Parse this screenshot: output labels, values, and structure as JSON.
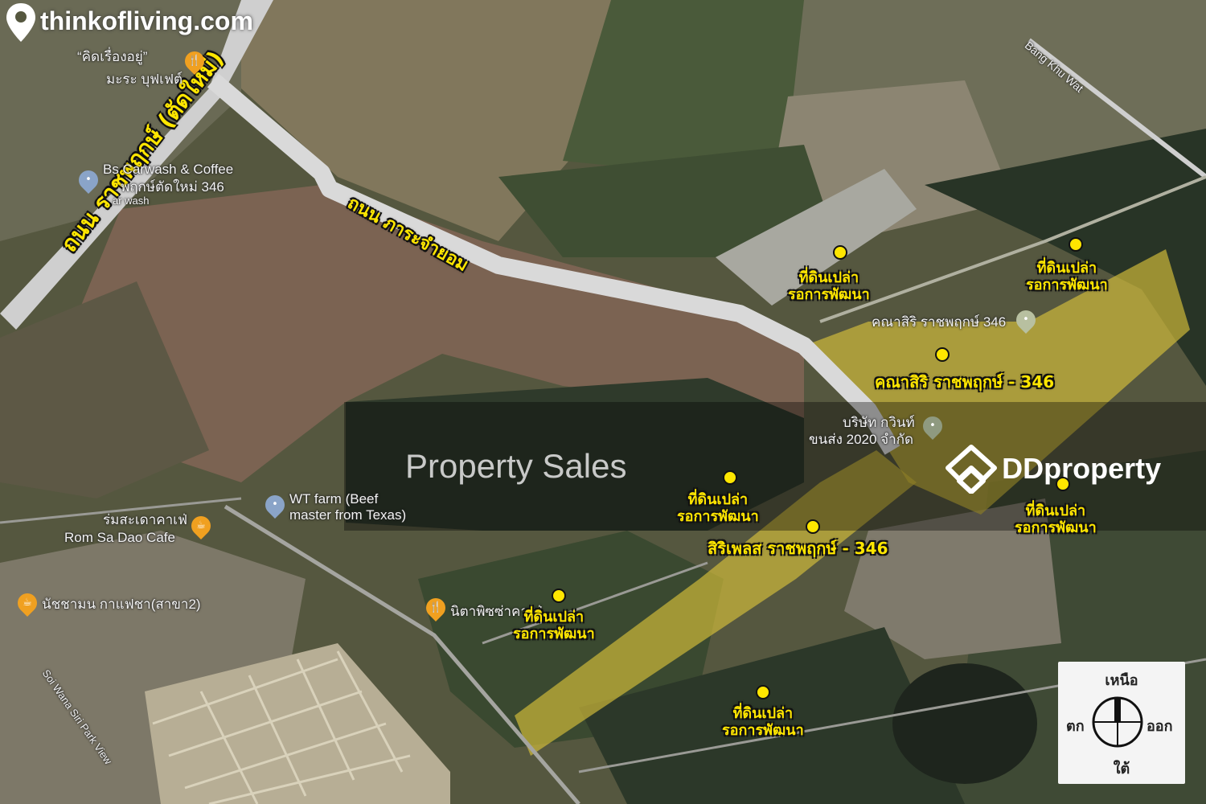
{
  "watermark": {
    "brand": "thinkofliving.com",
    "property_sales": "Property Sales",
    "ddproperty": "DDproperty"
  },
  "roads": {
    "main_highway": "ถนน ราชพฤกษ์ (ตัดใหม่)",
    "secondary_road": "ถนน ภาระจำยอม",
    "bang_khu_wat": "Bang Khu Wat",
    "soi_wana": "Soi Wana Siri Park View"
  },
  "poi": {
    "kid_tueng": "“คิดเรื่องอยู่”",
    "mara_buffet": "มะระ บุฟเฟต์",
    "carwash_line1": "Bs Carwash & Coffee",
    "carwash_line2": "พฤกษ์ตัดใหม่ 346",
    "carwash_line3": "ar wash",
    "wt_farm_line1": "WT farm (Beef",
    "wt_farm_line2": "master from Texas)",
    "rom_sa_dao_thai": "ร่มสะเดาคาเฟ่",
    "rom_sa_dao_en": "Rom Sa Dao Cafe",
    "natchamon": "นัชชามน กาแฟชา(สาขา2)",
    "nita_pizza": "นิตาพิซซ่าคาเฟ่",
    "kanasiri_poi": "คณาสิริ ราชพฤกษ์ 346",
    "company_line1": "บริษัท กวินท์",
    "company_line2": "ขนส่ง 2020 จำกัด"
  },
  "labels": {
    "vacant_line1": "ที่ดินเปล่า",
    "vacant_line2": "รอการพัฒนา",
    "kanasiri_project": "คณาสิริ ราชพฤกษ์ - 346",
    "siriplace_project": "สิริเพลส ราชพฤกษ์ - 346"
  },
  "compass": {
    "north": "เหนือ",
    "south": "ใต้",
    "east": "ออก",
    "west": "ตก"
  },
  "colors": {
    "marker": "#ffe600",
    "project_area": "#d8c23a",
    "road": "#d9d9d9"
  },
  "icons": {
    "logo": "map-pin-logo-icon",
    "restaurant": "fork-knife-icon",
    "location": "location-pin-icon",
    "cafe": "coffee-cup-icon"
  }
}
